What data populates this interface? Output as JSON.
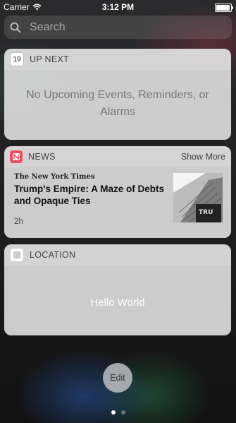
{
  "status_bar": {
    "carrier": "Carrier",
    "time": "3:12 PM",
    "battery_level": 0.95
  },
  "search": {
    "placeholder": "Search"
  },
  "widgets": {
    "up_next": {
      "title": "UP NEXT",
      "date_icon": "19",
      "message": "No Upcoming Events, Reminders, or Alarms"
    },
    "news": {
      "title": "NEWS",
      "show_more": "Show More",
      "source": "The New York Times",
      "headline": "Trump's Empire: A Maze of Debts and Opaque Ties",
      "age": "2h",
      "thumbnail_sign": "TRU"
    },
    "location": {
      "title": "LOCATION",
      "content": "Hello World"
    }
  },
  "edit_button": {
    "label": "Edit"
  },
  "page_dots": {
    "count": 2,
    "active_index": 0
  },
  "colors": {
    "news_icon": "#f2495c",
    "white": "#ffffff"
  }
}
